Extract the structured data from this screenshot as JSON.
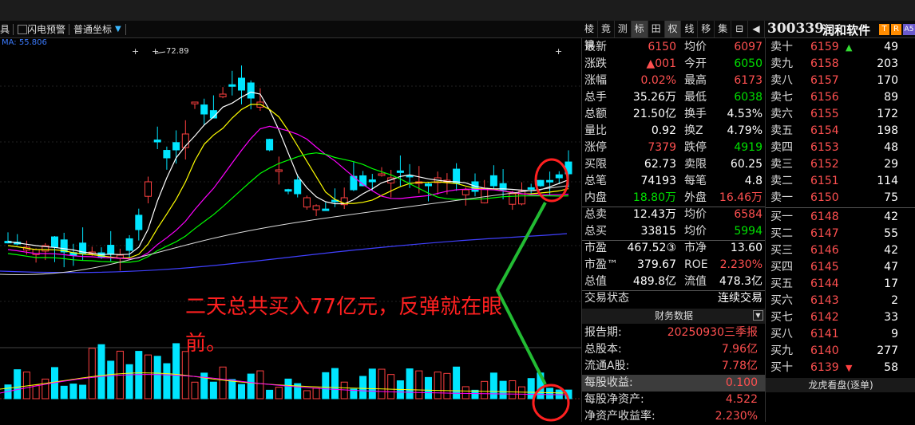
{
  "toolbar": {
    "item1": "具",
    "item2": "闪电预警",
    "item3": "普通坐标",
    "ma_text": "MA: 55.806"
  },
  "quote_tabs": [
    "棱镜",
    "竟",
    "测",
    "标",
    "田",
    "权",
    "线",
    "移",
    "集"
  ],
  "quote_selected": "标",
  "stock": {
    "code": "300339",
    "name": "润和软件",
    "badge1": "T",
    "badge2": "R",
    "badge3": "A5"
  },
  "price_annotation": "72.89",
  "annotation_text_line1": "二天总共买入77亿元，反弹就在眼",
  "annotation_text_line2": "前。",
  "quote": [
    {
      "l1": "最新",
      "v1": "6150",
      "c1": "red",
      "l2": "均价",
      "v2": "6097",
      "c2": "red"
    },
    {
      "l1": "涨跌",
      "v1": "▲001",
      "c1": "red",
      "l2": "今开",
      "v2": "6050",
      "c2": "grn"
    },
    {
      "l1": "涨幅",
      "v1": "0.02%",
      "c1": "red",
      "l2": "最高",
      "v2": "6173",
      "c2": "red"
    },
    {
      "l1": "总手",
      "v1": "35.26万",
      "c1": "wht",
      "l2": "最低",
      "v2": "6038",
      "c2": "grn"
    },
    {
      "l1": "总额",
      "v1": "21.50亿",
      "c1": "wht",
      "l2": "换手",
      "v2": "4.53%",
      "c2": "wht"
    },
    {
      "l1": "量比",
      "v1": "0.92",
      "c1": "wht",
      "l2": "换Z",
      "v2": "4.79%",
      "c2": "wht"
    },
    {
      "l1": "涨停",
      "v1": "7379",
      "c1": "red",
      "l2": "跌停",
      "v2": "4919",
      "c2": "grn"
    },
    {
      "l1": "买限",
      "v1": "62.73",
      "c1": "wht",
      "l2": "卖限",
      "v2": "60.25",
      "c2": "wht"
    },
    {
      "l1": "总笔",
      "v1": "74193",
      "c1": "wht",
      "l2": "每笔",
      "v2": "4.8",
      "c2": "wht"
    },
    {
      "l1": "内盘",
      "v1": "18.80万",
      "c1": "grn",
      "l2": "外盘",
      "v2": "16.46万",
      "c2": "red"
    },
    {
      "l1": "总卖",
      "v1": "12.43万",
      "c1": "wht",
      "l2": "均价",
      "v2": "6584",
      "c2": "red"
    },
    {
      "l1": "总买",
      "v1": "33815",
      "c1": "wht",
      "l2": "均价",
      "v2": "5994",
      "c2": "grn"
    },
    {
      "l1": "市盈",
      "v1": "467.52③",
      "c1": "wht",
      "l2": "市净",
      "v2": "13.60",
      "c2": "wht"
    },
    {
      "l1": "市盈™",
      "v1": "379.67",
      "c1": "wht",
      "l2": "ROE",
      "v2": "2.230%",
      "c2": "red"
    },
    {
      "l1": "总值",
      "v1": "489.8亿",
      "c1": "wht",
      "l2": "流值",
      "v2": "478.3亿",
      "c2": "wht"
    },
    {
      "l1": "交易状态",
      "v1": "",
      "c1": "wht",
      "l2": "",
      "v2": "连续交易",
      "c2": "wht"
    }
  ],
  "finance": {
    "title": "财务数据",
    "rows": [
      {
        "l": "报告期:",
        "v": "20250930三季报",
        "c": "red"
      },
      {
        "l": "总股本:",
        "v": "7.96亿",
        "c": "red"
      },
      {
        "l": "流通A股:",
        "v": "7.78亿",
        "c": "red"
      },
      {
        "l": "每股收益:",
        "v": "0.100",
        "c": "red"
      },
      {
        "l": "每股净资产:",
        "v": "4.522",
        "c": "red"
      },
      {
        "l": "净资产收益率:",
        "v": "2.230%",
        "c": "red"
      }
    ]
  },
  "orderbook": {
    "sell": [
      {
        "l": "卖十",
        "p": "6159",
        "v": "49",
        "arrow": "up"
      },
      {
        "l": "卖九",
        "p": "6158",
        "v": "203"
      },
      {
        "l": "卖八",
        "p": "6157",
        "v": "170"
      },
      {
        "l": "卖七",
        "p": "6156",
        "v": "89"
      },
      {
        "l": "卖六",
        "p": "6155",
        "v": "172"
      },
      {
        "l": "卖五",
        "p": "6154",
        "v": "198"
      },
      {
        "l": "卖四",
        "p": "6153",
        "v": "48"
      },
      {
        "l": "卖三",
        "p": "6152",
        "v": "29"
      },
      {
        "l": "卖二",
        "p": "6151",
        "v": "114"
      },
      {
        "l": "卖一",
        "p": "6150",
        "v": "75"
      }
    ],
    "buy": [
      {
        "l": "买一",
        "p": "6148",
        "v": "42"
      },
      {
        "l": "买二",
        "p": "6147",
        "v": "55"
      },
      {
        "l": "买三",
        "p": "6146",
        "v": "42"
      },
      {
        "l": "买四",
        "p": "6145",
        "v": "47"
      },
      {
        "l": "买五",
        "p": "6144",
        "v": "17"
      },
      {
        "l": "买六",
        "p": "6143",
        "v": "2"
      },
      {
        "l": "买七",
        "p": "6142",
        "v": "33"
      },
      {
        "l": "买八",
        "p": "6141",
        "v": "9"
      },
      {
        "l": "买九",
        "p": "6140",
        "v": "277"
      },
      {
        "l": "买十",
        "p": "6139",
        "v": "58",
        "arrow": "down"
      }
    ],
    "footer": "龙虎看盘(逐单)"
  },
  "colors": {
    "up": "#ff4040",
    "down": "#00e5ff",
    "ma5": "#ffffff",
    "ma10": "#ffff00",
    "ma20": "#ff00ff",
    "ma30": "#00ff00",
    "ma60": "#4040ff",
    "ma120": "#dddddd",
    "annotation": "#ff2020",
    "arrow_line": "#22bb33"
  }
}
